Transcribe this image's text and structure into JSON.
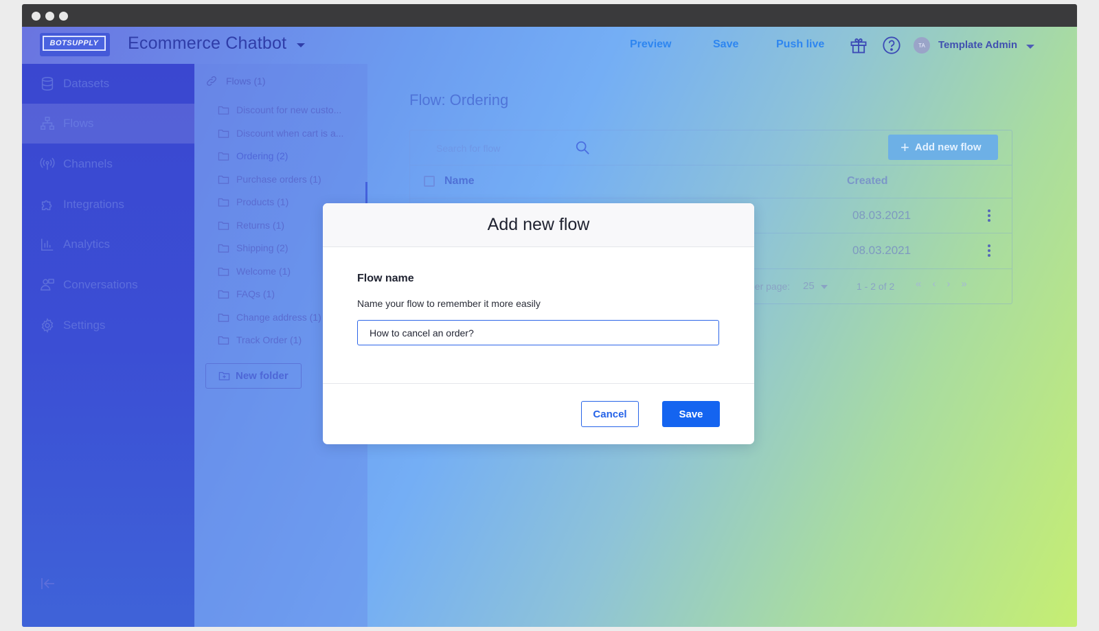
{
  "header": {
    "logo": "BOTSUPPLY",
    "title": "Ecommerce Chatbot",
    "links": {
      "preview": "Preview",
      "save": "Save",
      "push_live": "Push live"
    },
    "user_initials": "TA",
    "user_name": "Template Admin"
  },
  "sidebar": {
    "items": [
      {
        "label": "Datasets",
        "icon": "database-icon"
      },
      {
        "label": "Flows",
        "icon": "flows-icon",
        "active": true
      },
      {
        "label": "Channels",
        "icon": "broadcast-icon"
      },
      {
        "label": "Integrations",
        "icon": "puzzle-icon"
      },
      {
        "label": "Analytics",
        "icon": "bar-chart-icon"
      },
      {
        "label": "Conversations",
        "icon": "users-icon"
      },
      {
        "label": "Settings",
        "icon": "gear-icon"
      }
    ]
  },
  "folders": {
    "header": "Flows (1)",
    "items": [
      "Discount for new custo...",
      "Discount when cart is a...",
      "Ordering (2)",
      "Purchase orders (1)",
      "Products (1)",
      "Returns (1)",
      "Shipping (2)",
      "Welcome (1)",
      "FAQs (1)",
      "Change address (1)",
      "Track Order (1)"
    ],
    "active_index": 2,
    "new_folder_label": "New folder"
  },
  "main": {
    "title": "Flow: Ordering",
    "search_placeholder": "Search for flow",
    "add_flow_label": "Add new flow",
    "columns": {
      "name": "Name",
      "created": "Created"
    },
    "rows": [
      {
        "created": "08.03.2021"
      },
      {
        "created": "08.03.2021"
      }
    ],
    "pagination": {
      "per_page_label": "per page:",
      "per_page_value": "25",
      "range": "1 - 2 of 2"
    }
  },
  "modal": {
    "title": "Add new flow",
    "field_label": "Flow name",
    "field_help": "Name your flow to remember it more easily",
    "field_value": "How to cancel an order?",
    "cancel_label": "Cancel",
    "save_label": "Save"
  }
}
